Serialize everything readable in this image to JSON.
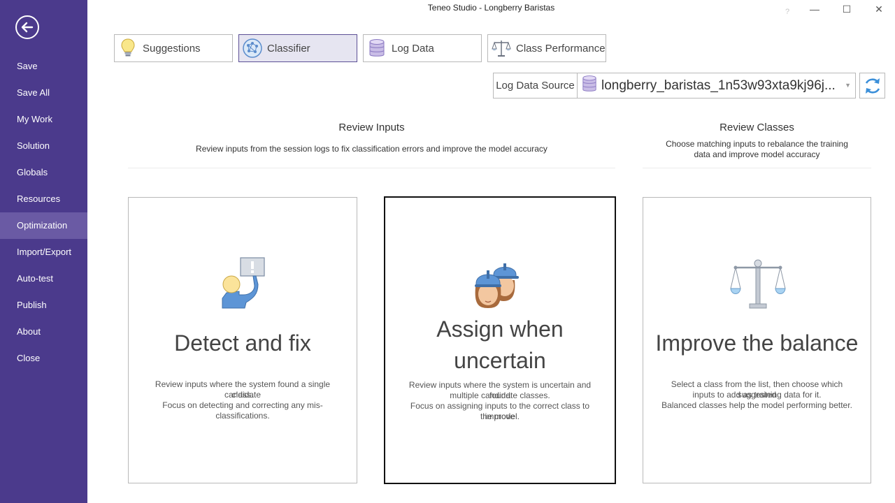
{
  "window": {
    "title": "Teneo Studio - Longberry Baristas",
    "help": "?",
    "minimize": "—",
    "maximize": "☐",
    "close": "✕"
  },
  "sidebar": {
    "items": [
      {
        "label": "Save"
      },
      {
        "label": "Save All"
      },
      {
        "label": "My Work"
      },
      {
        "label": "Solution"
      },
      {
        "label": "Globals"
      },
      {
        "label": "Resources"
      },
      {
        "label": "Optimization",
        "active": true
      },
      {
        "label": "Import/Export"
      },
      {
        "label": "Auto-test"
      },
      {
        "label": "Publish"
      },
      {
        "label": "About"
      },
      {
        "label": "Close"
      }
    ]
  },
  "tabs": [
    {
      "label": "Suggestions",
      "icon": "lightbulb-icon"
    },
    {
      "label": "Classifier",
      "icon": "classifier-icon",
      "active": true
    },
    {
      "label": "Log Data",
      "icon": "database-icon"
    },
    {
      "label": "Class Performance",
      "icon": "scales-icon"
    }
  ],
  "log_data_source": {
    "label": "Log Data Source",
    "value": "longberry_baristas_1n53w93xta9kj96j..."
  },
  "review_inputs": {
    "title": "Review Inputs",
    "description": "Review inputs from the session logs to fix classification errors and improve the model accuracy"
  },
  "review_classes": {
    "title": "Review Classes",
    "description_line1": "Choose matching inputs to rebalance the training",
    "description_line2": "data and improve model accuracy"
  },
  "cards": {
    "detect": {
      "title": "Detect and fix",
      "desc1": "Review inputs where the system found a single candidate",
      "desc2": "class.",
      "desc3": "Focus on detecting and correcting any mis-classifications."
    },
    "assign": {
      "title_line1": "Assign when",
      "title_line2": "uncertain",
      "desc1": "Review inputs where the system is uncertain and found",
      "desc2": "multiple candidate classes.",
      "desc3": "Focus on assigning inputs to the correct class to improve",
      "desc4": "the model.",
      "selected": true
    },
    "balance": {
      "title": "Improve the balance",
      "desc1": "Select a class from the list, then choose which suggested",
      "desc2": "inputs to add as training data for it.",
      "desc3": "Balanced classes help the model performing better."
    }
  },
  "colors": {
    "sidebar": "#4b3a8c",
    "sidebar_active": "#6a5aa4",
    "accent_blue": "#3b8fd9",
    "tab_active_bg": "#e6e5f1"
  }
}
